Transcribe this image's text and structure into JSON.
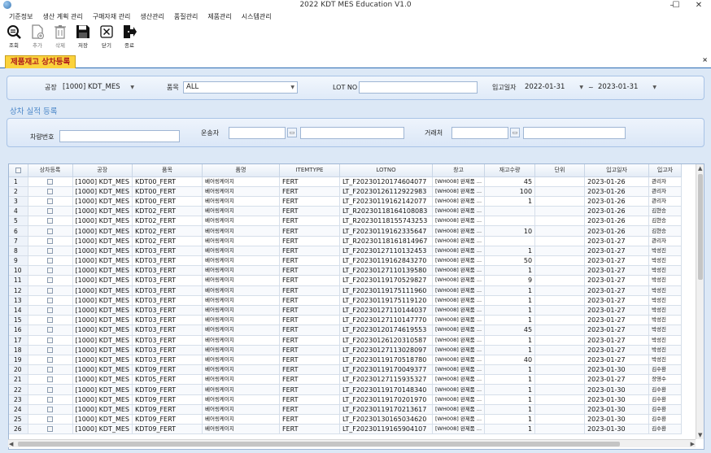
{
  "window": {
    "title": "2022 KDT MES Education V1.0",
    "min": "–",
    "max": "☐",
    "close": "✕"
  },
  "menu": [
    "기준정보",
    "생산 계획 관리",
    "구매자재 관리",
    "생산관리",
    "품질관리",
    "제품관리",
    "시스템관리"
  ],
  "toolbar": {
    "search": "조회",
    "add": "추가",
    "delete": "삭제",
    "save": "저장",
    "close": "닫기",
    "exit": "종료"
  },
  "tab": {
    "label": "제품재고 상차등록",
    "close": "×"
  },
  "filter": {
    "plant_label": "공장",
    "plant_value": "[1000] KDT_MES",
    "item_label": "품목",
    "item_value": "ALL",
    "lot_label": "LOT NO",
    "lot_value": "",
    "date_label": "입고일자",
    "date_from": "2022-01-31",
    "date_sep": "~",
    "date_to": "2023-01-31"
  },
  "register": {
    "title": "상차 실적 등록",
    "vehicle_label": "차량번호",
    "vehicle_value": "",
    "driver_label": "운송자",
    "driver_code": "",
    "driver_name": "",
    "customer_label": "거래처",
    "customer_code": "",
    "customer_name": ""
  },
  "grid": {
    "columns": [
      "",
      "상차등록",
      "공장",
      "품목",
      "품명",
      "ITEMTYPE",
      "LOTNO",
      "창고",
      "재고수량",
      "단위",
      "입고일자",
      "입고자"
    ],
    "rows": [
      [
        "1",
        "[1000] KDT_MES",
        "KDT00_FERT",
        "베어링케이지",
        "FERT",
        "LT_F20230120174604077",
        "[WH008] 완제품 ...",
        "45",
        "",
        "2023-01-26",
        "관리자"
      ],
      [
        "2",
        "[1000] KDT_MES",
        "KDT00_FERT",
        "베어링케이지",
        "FERT",
        "LT_F20230126112922983",
        "[WH008] 완제품 ...",
        "100",
        "",
        "2023-01-26",
        "관리자"
      ],
      [
        "3",
        "[1000] KDT_MES",
        "KDT00_FERT",
        "베어링케이지",
        "FERT",
        "LT_F20230119162142077",
        "[WH008] 완제품 ...",
        "1",
        "",
        "2023-01-26",
        "관리자"
      ],
      [
        "4",
        "[1000] KDT_MES",
        "KDT02_FERT",
        "베어링케이지",
        "FERT",
        "LT_R20230118164108083",
        "[WH008] 완제품 ...",
        "",
        "",
        "2023-01-26",
        "김현승"
      ],
      [
        "5",
        "[1000] KDT_MES",
        "KDT02_FERT",
        "베어링케이지",
        "FERT",
        "LT_R20230118155743253",
        "[WH008] 완제품 ...",
        "",
        "",
        "2023-01-26",
        "김현승"
      ],
      [
        "6",
        "[1000] KDT_MES",
        "KDT02_FERT",
        "베어링케이지",
        "FERT",
        "LT_F20230119162335647",
        "[WH008] 완제품 ...",
        "10",
        "",
        "2023-01-26",
        "김현승"
      ],
      [
        "7",
        "[1000] KDT_MES",
        "KDT02_FERT",
        "베어링케이지",
        "FERT",
        "LT_R20230118161814967",
        "[WH008] 완제품 ...",
        "",
        "",
        "2023-01-27",
        "관리자"
      ],
      [
        "8",
        "[1000] KDT_MES",
        "KDT03_FERT",
        "베어링케이지",
        "FERT",
        "LT_F20230127110132453",
        "[WH008] 완제품 ...",
        "1",
        "",
        "2023-01-27",
        "박성진"
      ],
      [
        "9",
        "[1000] KDT_MES",
        "KDT03_FERT",
        "베어링케이지",
        "FERT",
        "LT_F20230119162843270",
        "[WH008] 완제품 ...",
        "50",
        "",
        "2023-01-27",
        "박성진"
      ],
      [
        "10",
        "[1000] KDT_MES",
        "KDT03_FERT",
        "베어링케이지",
        "FERT",
        "LT_F20230127110139580",
        "[WH008] 완제품 ...",
        "1",
        "",
        "2023-01-27",
        "박성진"
      ],
      [
        "11",
        "[1000] KDT_MES",
        "KDT03_FERT",
        "베어링케이지",
        "FERT",
        "LT_F20230119170529827",
        "[WH008] 완제품 ...",
        "9",
        "",
        "2023-01-27",
        "박성진"
      ],
      [
        "12",
        "[1000] KDT_MES",
        "KDT03_FERT",
        "베어링케이지",
        "FERT",
        "LT_F20230119175111960",
        "[WH008] 완제품 ...",
        "1",
        "",
        "2023-01-27",
        "박성진"
      ],
      [
        "13",
        "[1000] KDT_MES",
        "KDT03_FERT",
        "베어링케이지",
        "FERT",
        "LT_F20230119175119120",
        "[WH008] 완제품 ...",
        "1",
        "",
        "2023-01-27",
        "박성진"
      ],
      [
        "14",
        "[1000] KDT_MES",
        "KDT03_FERT",
        "베어링케이지",
        "FERT",
        "LT_F20230127110144037",
        "[WH008] 완제품 ...",
        "1",
        "",
        "2023-01-27",
        "박성진"
      ],
      [
        "15",
        "[1000] KDT_MES",
        "KDT03_FERT",
        "베어링케이지",
        "FERT",
        "LT_F20230127110147770",
        "[WH008] 완제품 ...",
        "1",
        "",
        "2023-01-27",
        "박성진"
      ],
      [
        "16",
        "[1000] KDT_MES",
        "KDT03_FERT",
        "베어링케이지",
        "FERT",
        "LT_F20230120174619553",
        "[WH008] 완제품 ...",
        "45",
        "",
        "2023-01-27",
        "박성진"
      ],
      [
        "17",
        "[1000] KDT_MES",
        "KDT03_FERT",
        "베어링케이지",
        "FERT",
        "LT_F20230126120310587",
        "[WH008] 완제품 ...",
        "1",
        "",
        "2023-01-27",
        "박성진"
      ],
      [
        "18",
        "[1000] KDT_MES",
        "KDT03_FERT",
        "베어링케이지",
        "FERT",
        "LT_F20230127113028097",
        "[WH008] 완제품 ...",
        "1",
        "",
        "2023-01-27",
        "박성진"
      ],
      [
        "19",
        "[1000] KDT_MES",
        "KDT03_FERT",
        "베어링케이지",
        "FERT",
        "LT_F20230119170518780",
        "[WH008] 완제품 ...",
        "40",
        "",
        "2023-01-27",
        "박성진"
      ],
      [
        "20",
        "[1000] KDT_MES",
        "KDT09_FERT",
        "베어링케이지",
        "FERT",
        "LT_F20230119170049377",
        "[WH008] 완제품 ...",
        "1",
        "",
        "2023-01-30",
        "김수환"
      ],
      [
        "21",
        "[1000] KDT_MES",
        "KDT05_FERT",
        "베어링케이지",
        "FERT",
        "LT_F20230127115935327",
        "[WH008] 완제품 ...",
        "1",
        "",
        "2023-01-27",
        "장영수"
      ],
      [
        "22",
        "[1000] KDT_MES",
        "KDT09_FERT",
        "베어링케이지",
        "FERT",
        "LT_F20230119170148340",
        "[WH008] 완제품 ...",
        "1",
        "",
        "2023-01-30",
        "김수환"
      ],
      [
        "23",
        "[1000] KDT_MES",
        "KDT09_FERT",
        "베어링케이지",
        "FERT",
        "LT_F20230119170201970",
        "[WH008] 완제품 ...",
        "1",
        "",
        "2023-01-30",
        "김수환"
      ],
      [
        "24",
        "[1000] KDT_MES",
        "KDT09_FERT",
        "베어링케이지",
        "FERT",
        "LT_F20230119170213617",
        "[WH008] 완제품 ...",
        "1",
        "",
        "2023-01-30",
        "김수환"
      ],
      [
        "25",
        "[1000] KDT_MES",
        "KDT09_FERT",
        "베어링케이지",
        "FERT",
        "LT_F20230130165034620",
        "[WH008] 완제품 ...",
        "1",
        "",
        "2023-01-30",
        "김수환"
      ],
      [
        "26",
        "[1000] KDT_MES",
        "KDT09_FERT",
        "베어링케이지",
        "FERT",
        "LT_F20230119165904107",
        "[WH008] 완제품 ...",
        "1",
        "",
        "2023-01-30",
        "김수환"
      ]
    ]
  },
  "colors": {
    "tab_bg": "#fbd23c",
    "tab_text": "#b0201c",
    "panel_bg": "#dce8f6",
    "accent": "#2e6db4"
  }
}
